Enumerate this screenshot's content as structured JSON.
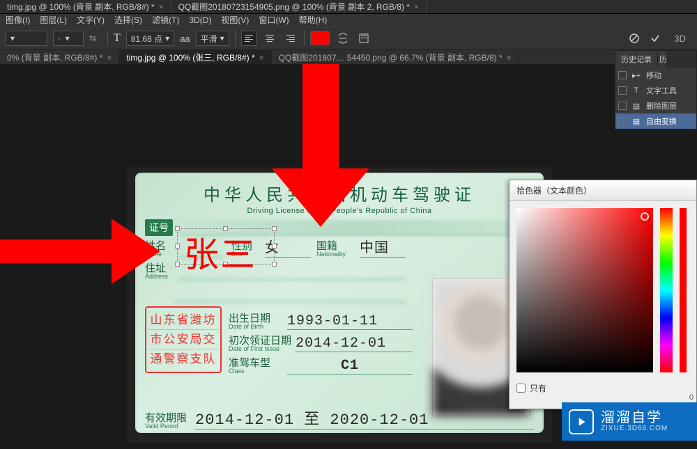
{
  "top_tabs": [
    "timg.jpg @ 100% (背景 副本, RGB/8#) *",
    "QQ截图20180723154905.png @ 100% (背景 副本 2, RGB/8) *"
  ],
  "menubar": [
    "图像(I)",
    "图层(L)",
    "文字(Y)",
    "选择(S)",
    "滤镜(T)",
    "3D(D)",
    "视图(V)",
    "窗口(W)",
    "帮助(H)"
  ],
  "options": {
    "font_size": "81.68 点",
    "aa_label": "aa",
    "smoothing": "平滑",
    "color": "#ff0000",
    "threeD": "3D"
  },
  "doc_tabs": [
    {
      "label": "0% (背景 副本, RGB/8#) *",
      "active": false
    },
    {
      "label": "timg.jpg @ 100% (张三, RGB/8#) *",
      "active": true
    },
    {
      "label": "QQ截图201807… 54450.png @ 66.7% (背景 副本, RGB/8) *",
      "active": false
    }
  ],
  "history": {
    "title": "历史记录",
    "side": "历",
    "items": [
      {
        "icon": "▸+",
        "label": "移动"
      },
      {
        "icon": "T",
        "label": "文字工具"
      },
      {
        "icon": "▤",
        "label": "删除图层"
      },
      {
        "icon": "▤",
        "label": "自由变换"
      }
    ],
    "active_index": 3
  },
  "color_picker": {
    "title": "拾色器（文本颜色）",
    "only_web_label": "只有",
    "zero": "0"
  },
  "license": {
    "title_cn": "中华人民共和国机动车驾驶证",
    "title_en": "Driving License of the People's Republic of China",
    "idno_label": "证号",
    "name_lab_cn": "姓名",
    "name_lab_en": "Name",
    "sex_lab_cn": "性别",
    "sex_lab_en": "Sex",
    "sex_val": "女",
    "nat_lab_cn": "国籍",
    "nat_lab_en": "Nationality",
    "nat_val": "中国",
    "addr_lab_cn": "住址",
    "addr_lab_en": "Address",
    "dob_lab_cn": "出生日期",
    "dob_lab_en": "Date of Birth",
    "dob_val": "1993-01-11",
    "first_lab_cn": "初次领证日期",
    "first_lab_en": "Date of First Issue",
    "first_val": "2014-12-01",
    "class_lab_cn": "准驾车型",
    "class_lab_en": "Class",
    "class_val": "C1",
    "valid_lab_cn": "有效期限",
    "valid_lab_en": "Valid Period",
    "valid_val": "2014-12-01 至 2020-12-01",
    "stamp_l1": "山东省潍坊",
    "stamp_l2": "市公安局交",
    "stamp_l3": "通警察支队",
    "typed_text": "张三"
  },
  "watermark": {
    "big": "溜溜自学",
    "small": "ZIXUE.3D66.COM"
  }
}
